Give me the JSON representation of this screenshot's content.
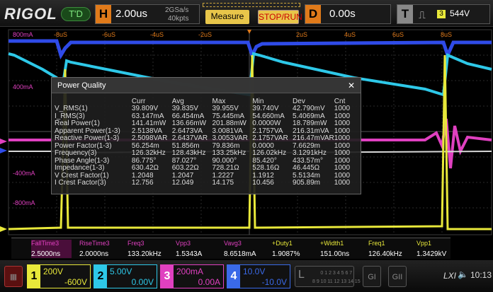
{
  "header": {
    "brand": "RIGOL",
    "status_badge": "T'D",
    "horizontal": {
      "key": "H",
      "timebase": "2.00us",
      "sample_rate": "2GSa/s",
      "points": "40kpts"
    },
    "measure_label": "Measure",
    "stoprun_label": "STOP/RUN",
    "delay": {
      "key": "D",
      "value": "0.00s"
    },
    "trigger": {
      "key": "T",
      "edge": "⎍",
      "source": "3",
      "level": "544V"
    }
  },
  "axes": {
    "time_labels": [
      "-8uS",
      "-6uS",
      "-4uS",
      "-2uS",
      "",
      "2uS",
      "4uS",
      "6uS",
      "8uS"
    ],
    "ch3_labels": [
      "800mA",
      "400mA",
      "-400mA",
      "-800mA"
    ]
  },
  "panel": {
    "title": "Power Quality",
    "close": "✕",
    "columns": [
      "",
      "Curr",
      "Avg",
      "Max",
      "Min",
      "Dev",
      "Cnt"
    ],
    "rows": [
      {
        "name": "V_RMS(1)",
        "v": [
          "39.809V",
          "39.835V",
          "39.955V",
          "39.740V",
          "42.790mV",
          "1000"
        ]
      },
      {
        "name": "I_RMS(3)",
        "v": [
          "63.147mA",
          "66.454mA",
          "75.445mA",
          "54.660mA",
          "5.4069mA",
          "1000"
        ]
      },
      {
        "name": "Real Power(1)",
        "v": [
          "141.41mW",
          "136.66mW",
          "201.88mW",
          "0.0000W",
          "18.789mW",
          "1000"
        ]
      },
      {
        "name": "Apparent Power(1-3)",
        "v": [
          "2.5138VA",
          "2.6473VA",
          "3.0081VA",
          "2.1757VA",
          "216.31mVA",
          "1000"
        ]
      },
      {
        "name": "Reactive Power(1-3)",
        "v": [
          "2.5098VAR",
          "2.6437VAR",
          "3.0053VAR",
          "2.1757VAR",
          "216.47mVAR",
          "1000"
        ]
      },
      {
        "name": "Power Factor(1-3)",
        "v": [
          "56.254m",
          "51.856m",
          "79.836m",
          "0.0000",
          "7.6629m",
          "1000"
        ]
      },
      {
        "name": "Frequency(3)",
        "v": [
          "126.32kHz",
          "128.43kHz",
          "133.25kHz",
          "126.02kHz",
          "3.1291kHz",
          "1000"
        ]
      },
      {
        "name": "Phase Angle(1-3)",
        "v": [
          "86.775°",
          "87.027°",
          "90.000°",
          "85.420°",
          "433.57m°",
          "1000"
        ]
      },
      {
        "name": "Impedance(1-3)",
        "v": [
          "630.42Ω",
          "603.22Ω",
          "728.21Ω",
          "528.16Ω",
          "46.445Ω",
          "1000"
        ]
      },
      {
        "name": "V Crest Factor(1)",
        "v": [
          "1.2048",
          "1.2047",
          "1.2227",
          "1.1912",
          "5.5134m",
          "1000"
        ]
      },
      {
        "name": "I Crest Factor(3)",
        "v": [
          "12.756",
          "12.049",
          "14.175",
          "10.456",
          "905.89m",
          "1000"
        ]
      }
    ]
  },
  "measurements": [
    {
      "label": "FallTime3",
      "value": "2.5000ns",
      "color": "#e040c0"
    },
    {
      "label": "RiseTime3",
      "value": "2.0000ns",
      "color": "#e040c0"
    },
    {
      "label": "Freq3",
      "value": "133.20kHz",
      "color": "#e040c0"
    },
    {
      "label": "Vpp3",
      "value": "1.5343A",
      "color": "#e040c0"
    },
    {
      "label": "Vavg3",
      "value": "8.6518mA",
      "color": "#e040c0"
    },
    {
      "label": "+Duty1",
      "value": "1.9087%",
      "color": "#e8e83a"
    },
    {
      "label": "+Width1",
      "value": "151.00ns",
      "color": "#e8e83a"
    },
    {
      "label": "Freq1",
      "value": "126.40kHz",
      "color": "#e8e83a"
    },
    {
      "label": "Vpp1",
      "value": "1.3429kV",
      "color": "#e8e83a"
    }
  ],
  "channels": [
    {
      "num": "1",
      "scale": "200V",
      "offset": "-600V",
      "color": "#e8e83a"
    },
    {
      "num": "2",
      "scale": "5.00V",
      "offset": "0.00V",
      "color": "#2ec8e8"
    },
    {
      "num": "3",
      "scale": "200mA",
      "offset": "0.00A",
      "color": "#e040c0"
    },
    {
      "num": "4",
      "scale": "10.0V",
      "offset": "-10.0V",
      "color": "#3a6ae8"
    }
  ],
  "footer": {
    "digital_label": "L",
    "digital_bits": "0 1 2 3 4 5 6 7\n8 9 10 11 12 13 14 15",
    "g1": "GI",
    "g2": "GII",
    "lxi": "LXI",
    "speaker": "🔈",
    "time": "10:13"
  }
}
